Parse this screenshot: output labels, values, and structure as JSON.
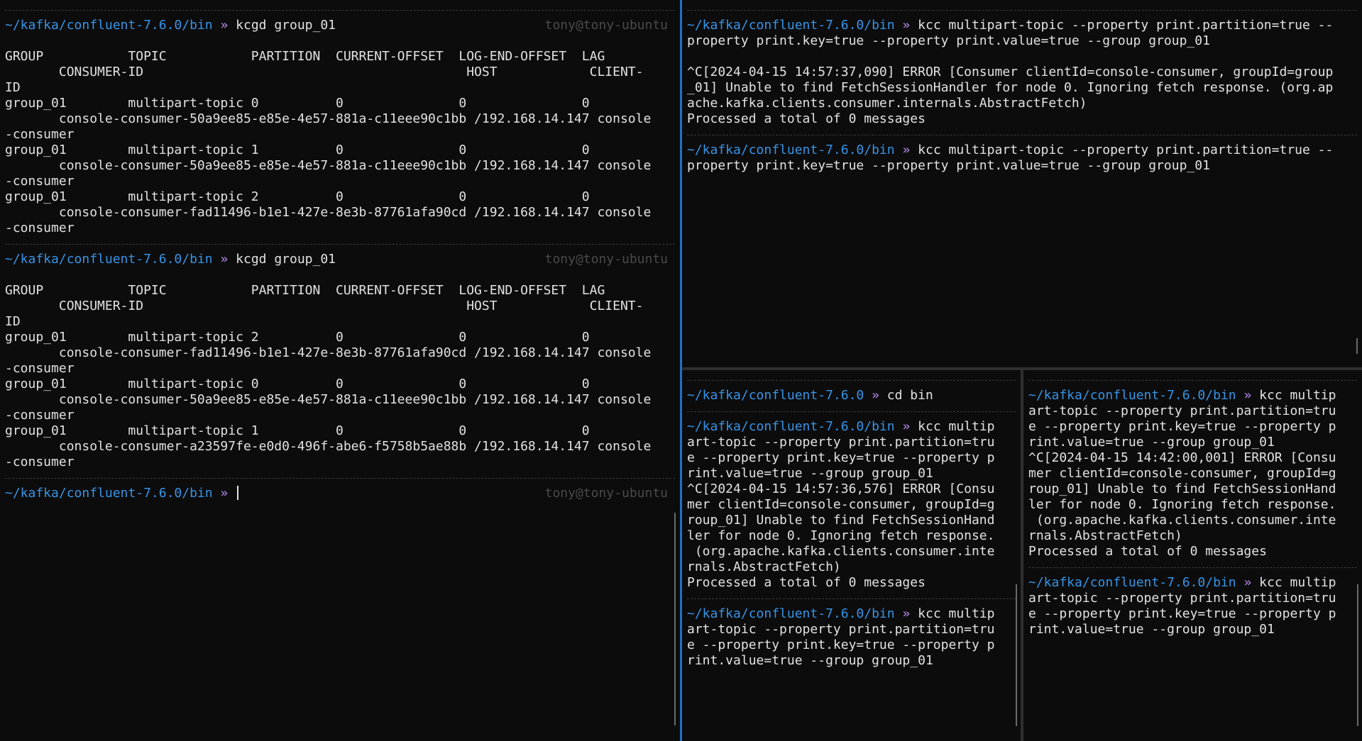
{
  "colors": {
    "background": "#0c0c0c",
    "path": "#3794e6",
    "prompt_arrow": "#b98cf0",
    "text": "#e2e2e2",
    "muted": "#4a4a4a",
    "active_divider": "#1e72c4"
  },
  "left_pane": {
    "blocks": [
      {
        "prompt": {
          "path": "~/kafka/confluent-7.6.0/bin",
          "arrow": "»",
          "command": "kcgd group_01",
          "user_host": "tony@tony-ubuntu"
        },
        "output": [
          "",
          "GROUP           TOPIC           PARTITION  CURRENT-OFFSET  LOG-END-OFFSET  LAG",
          "       CONSUMER-ID                                          HOST            CLIENT-",
          "ID",
          "group_01        multipart-topic 0          0               0               0",
          "       console-consumer-50a9ee85-e85e-4e57-881a-c11eee90c1bb /192.168.14.147 console",
          "-consumer",
          "group_01        multipart-topic 1          0               0               0",
          "       console-consumer-50a9ee85-e85e-4e57-881a-c11eee90c1bb /192.168.14.147 console",
          "-consumer",
          "group_01        multipart-topic 2          0               0               0",
          "       console-consumer-fad11496-b1e1-427e-8e3b-87761afa90cd /192.168.14.147 console",
          "-consumer"
        ]
      },
      {
        "prompt": {
          "path": "~/kafka/confluent-7.6.0/bin",
          "arrow": "»",
          "command": "kcgd group_01",
          "user_host": "tony@tony-ubuntu"
        },
        "output": [
          "",
          "GROUP           TOPIC           PARTITION  CURRENT-OFFSET  LOG-END-OFFSET  LAG",
          "       CONSUMER-ID                                          HOST            CLIENT-",
          "ID",
          "group_01        multipart-topic 2          0               0               0",
          "       console-consumer-fad11496-b1e1-427e-8e3b-87761afa90cd /192.168.14.147 console",
          "-consumer",
          "group_01        multipart-topic 0          0               0               0",
          "       console-consumer-50a9ee85-e85e-4e57-881a-c11eee90c1bb /192.168.14.147 console",
          "-consumer",
          "group_01        multipart-topic 1          0               0               0",
          "       console-consumer-a23597fe-e0d0-496f-abe6-f5758b5ae88b /192.168.14.147 console",
          "-consumer"
        ]
      }
    ],
    "current_prompt": {
      "path": "~/kafka/confluent-7.6.0/bin",
      "arrow": "»",
      "command": "",
      "user_host": "tony@tony-ubuntu"
    }
  },
  "top_right_pane": {
    "lines": [
      {
        "type": "sep"
      },
      {
        "type": "prompt",
        "path": "~/kafka/confluent-7.6.0/bin",
        "arrow": "»",
        "command": "kcc multipart-topic --property print.partition=true --"
      },
      {
        "type": "text",
        "text": "property print.key=true --property print.value=true --group group_01"
      },
      {
        "type": "blank"
      },
      {
        "type": "text",
        "text": "^C[2024-04-15 14:57:37,090] ERROR [Consumer clientId=console-consumer, groupId=group"
      },
      {
        "type": "text",
        "text": "_01] Unable to find FetchSessionHandler for node 0. Ignoring fetch response. (org.ap"
      },
      {
        "type": "text",
        "text": "ache.kafka.clients.consumer.internals.AbstractFetch)"
      },
      {
        "type": "text",
        "text": "Processed a total of 0 messages"
      },
      {
        "type": "sep"
      },
      {
        "type": "prompt",
        "path": "~/kafka/confluent-7.6.0/bin",
        "arrow": "»",
        "command": "kcc multipart-topic --property print.partition=true --"
      },
      {
        "type": "text",
        "text": "property print.key=true --property print.value=true --group group_01"
      }
    ]
  },
  "bottom_left_pane": {
    "lines": [
      {
        "type": "sep"
      },
      {
        "type": "prompt",
        "path": "~/kafka/confluent-7.6.0",
        "arrow": "»",
        "command": "cd bin"
      },
      {
        "type": "sep"
      },
      {
        "type": "prompt",
        "path": "~/kafka/confluent-7.6.0/bin",
        "arrow": "»",
        "command": "kcc multip"
      },
      {
        "type": "text",
        "text": "art-topic --property print.partition=tru"
      },
      {
        "type": "text",
        "text": "e --property print.key=true --property p"
      },
      {
        "type": "text",
        "text": "rint.value=true --group group_01"
      },
      {
        "type": "text",
        "text": "^C[2024-04-15 14:57:36,576] ERROR [Consu"
      },
      {
        "type": "text",
        "text": "mer clientId=console-consumer, groupId=g"
      },
      {
        "type": "text",
        "text": "roup_01] Unable to find FetchSessionHand"
      },
      {
        "type": "text",
        "text": "ler for node 0. Ignoring fetch response."
      },
      {
        "type": "text",
        "text": " (org.apache.kafka.clients.consumer.inte"
      },
      {
        "type": "text",
        "text": "rnals.AbstractFetch)"
      },
      {
        "type": "text",
        "text": "Processed a total of 0 messages"
      },
      {
        "type": "sep"
      },
      {
        "type": "prompt",
        "path": "~/kafka/confluent-7.6.0/bin",
        "arrow": "»",
        "command": "kcc multip"
      },
      {
        "type": "text",
        "text": "art-topic --property print.partition=tru"
      },
      {
        "type": "text",
        "text": "e --property print.key=true --property p"
      },
      {
        "type": "text",
        "text": "rint.value=true --group group_01"
      }
    ]
  },
  "bottom_right_pane": {
    "lines": [
      {
        "type": "sep"
      },
      {
        "type": "prompt",
        "path": "~/kafka/confluent-7.6.0/bin",
        "arrow": "»",
        "command": "kcc multip"
      },
      {
        "type": "text",
        "text": "art-topic --property print.partition=tru"
      },
      {
        "type": "text",
        "text": "e --property print.key=true --property p"
      },
      {
        "type": "text",
        "text": "rint.value=true --group group_01"
      },
      {
        "type": "text",
        "text": "^C[2024-04-15 14:42:00,001] ERROR [Consu"
      },
      {
        "type": "text",
        "text": "mer clientId=console-consumer, groupId=g"
      },
      {
        "type": "text",
        "text": "roup_01] Unable to find FetchSessionHand"
      },
      {
        "type": "text",
        "text": "ler for node 0. Ignoring fetch response."
      },
      {
        "type": "text",
        "text": " (org.apache.kafka.clients.consumer.inte"
      },
      {
        "type": "text",
        "text": "rnals.AbstractFetch)"
      },
      {
        "type": "text",
        "text": "Processed a total of 0 messages"
      },
      {
        "type": "sep"
      },
      {
        "type": "prompt",
        "path": "~/kafka/confluent-7.6.0/bin",
        "arrow": "»",
        "command": "kcc multip"
      },
      {
        "type": "text",
        "text": "art-topic --property print.partition=tru"
      },
      {
        "type": "text",
        "text": "e --property print.key=true --property p"
      },
      {
        "type": "text",
        "text": "rint.value=true --group group_01"
      }
    ]
  }
}
